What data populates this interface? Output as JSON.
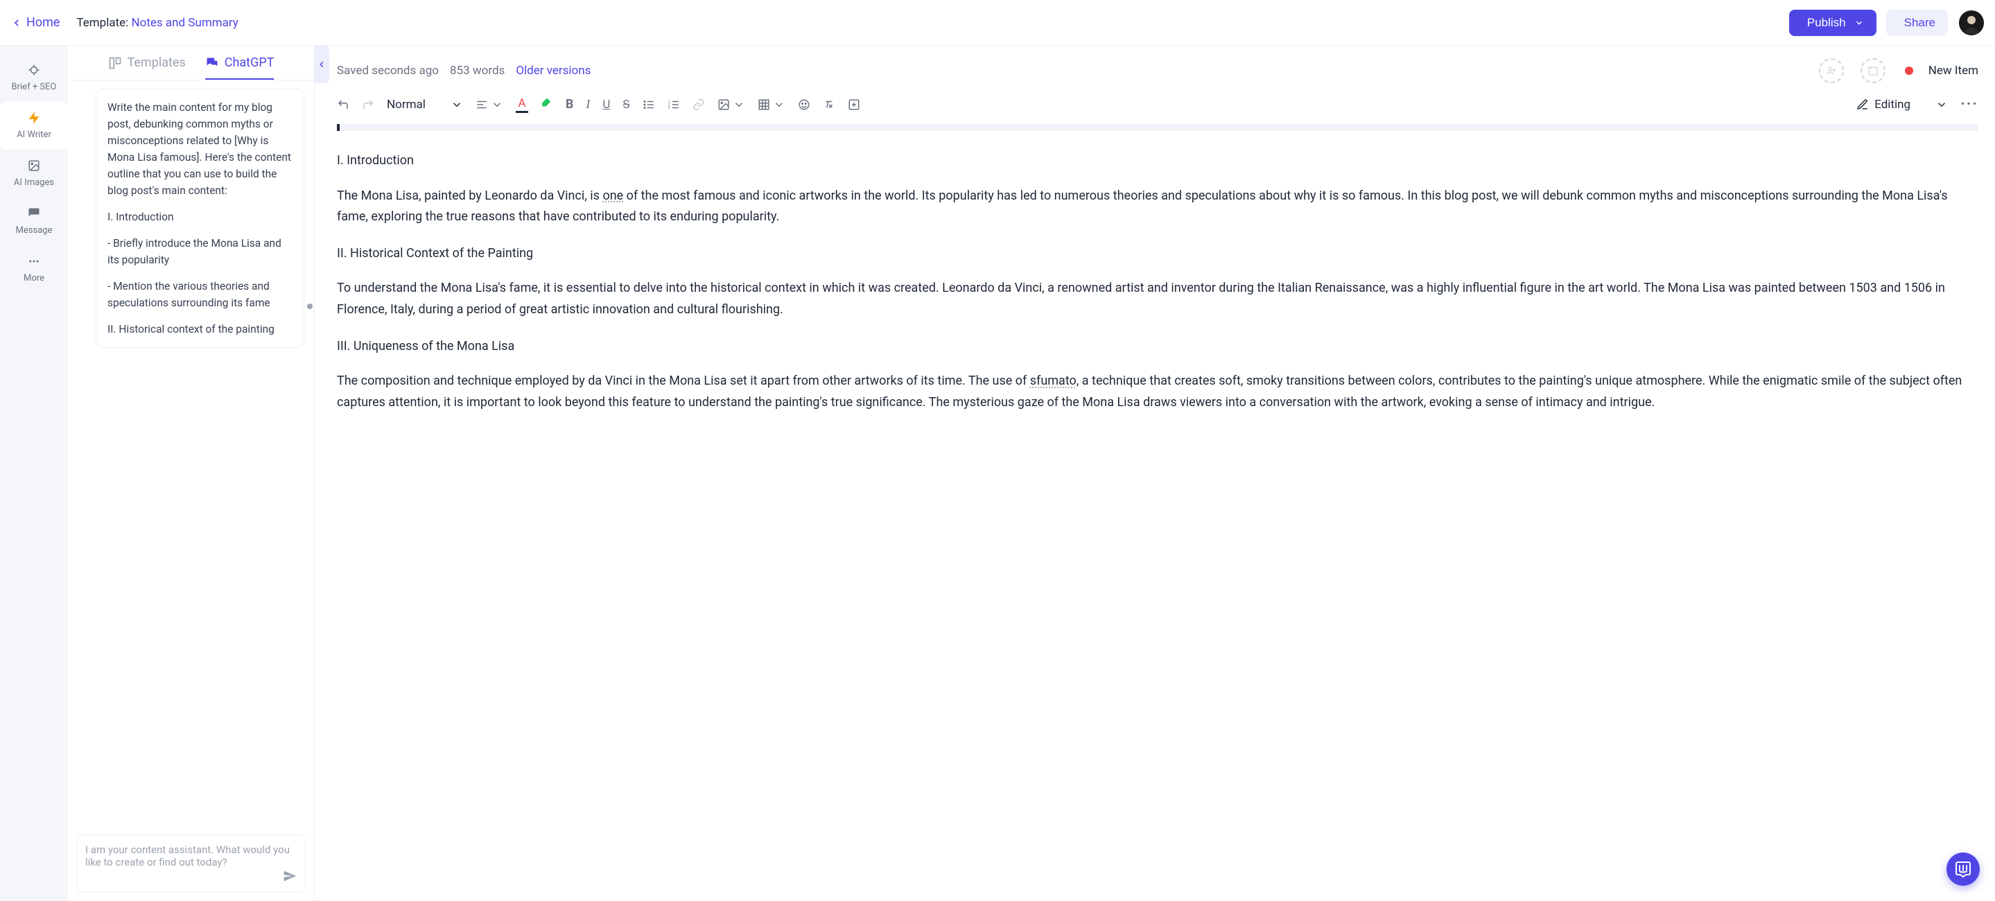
{
  "header": {
    "back_label": "Home",
    "template_prefix": "Template: ",
    "template_name": "Notes and Summary",
    "publish_label": "Publish",
    "share_label": "Share"
  },
  "leftnav": {
    "items": [
      {
        "icon": "target",
        "label": "Brief + SEO"
      },
      {
        "icon": "bolt",
        "label": "AI Writer"
      },
      {
        "icon": "image",
        "label": "AI Images"
      },
      {
        "icon": "chat",
        "label": "Message"
      },
      {
        "icon": "dots",
        "label": "More"
      }
    ]
  },
  "tabs": {
    "templates": "Templates",
    "chatgpt": "ChatGPT"
  },
  "chat": {
    "message_parts": [
      "Write the main content for my blog post, debunking common myths or misconceptions related to [Why is Mona Lisa famous]. Here's the content outline that you can use to build the blog post's main content:",
      "I. Introduction",
      "   - Briefly introduce the Mona Lisa and its popularity",
      "   - Mention the various theories and speculations surrounding its fame",
      "II. Historical context of the painting"
    ],
    "input_placeholder": "I am your content assistant. What would you like to create or find out today?"
  },
  "editor_meta": {
    "saved": "Saved seconds ago",
    "wordcount": "853 words",
    "older_versions": "Older versions",
    "status_label": "New Item"
  },
  "toolbar": {
    "style_label": "Normal",
    "editing_label": "Editing"
  },
  "document": {
    "sections": [
      {
        "heading": "I. Introduction",
        "body": "The Mona Lisa, painted by Leonardo da Vinci, is one of the most famous and iconic artworks in the world. Its popularity has led to numerous theories and speculations about why it is so famous. In this blog post, we will debunk common myths and misconceptions surrounding the Mona Lisa's fame, exploring the true reasons that have contributed to its enduring popularity.",
        "spell_word": "one"
      },
      {
        "heading": "II. Historical Context of the Painting",
        "body": "To understand the Mona Lisa's fame, it is essential to delve into the historical context in which it was created. Leonardo da Vinci, a renowned artist and inventor during the Italian Renaissance, was a highly influential figure in the art world. The Mona Lisa was painted between 1503 and 1506 in Florence, Italy, during a period of great artistic innovation and cultural flourishing.",
        "spell_word": ""
      },
      {
        "heading": "III. Uniqueness of the Mona Lisa",
        "body": "The composition and technique employed by da Vinci in the Mona Lisa set it apart from other artworks of its time. The use of sfumato, a technique that creates soft, smoky transitions between colors, contributes to the painting's unique atmosphere. While the enigmatic smile of the subject often captures attention, it is important to look beyond this feature to understand the painting's true significance. The mysterious gaze of the Mona Lisa draws viewers into a conversation with the artwork, evoking a sense of intimacy and intrigue.",
        "spell_word": "sfumato"
      }
    ]
  }
}
